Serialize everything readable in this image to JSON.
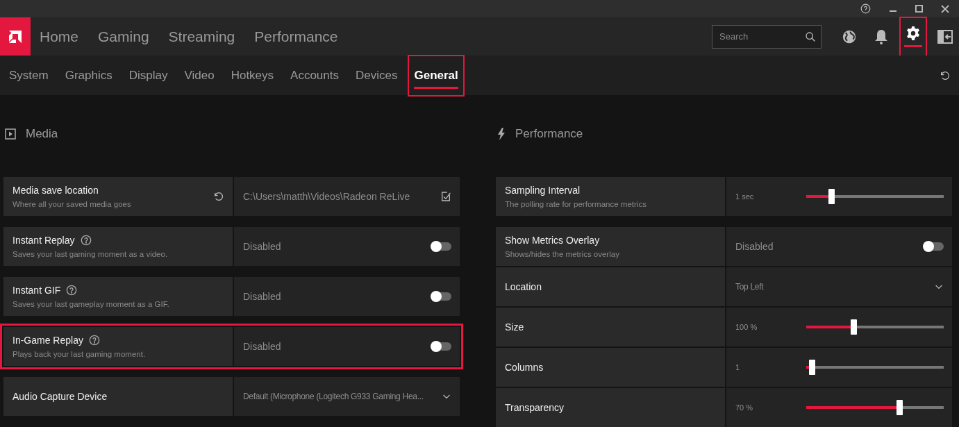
{
  "nav": {
    "tabs": [
      {
        "label": "Home",
        "selected": false
      },
      {
        "label": "Gaming",
        "selected": false
      },
      {
        "label": "Streaming",
        "selected": false
      },
      {
        "label": "Performance",
        "selected": false
      }
    ],
    "search": {
      "placeholder": "Search"
    },
    "settings_highlighted": true
  },
  "subtabs": [
    {
      "label": "System",
      "selected": false,
      "highlighted": false
    },
    {
      "label": "Graphics",
      "selected": false,
      "highlighted": false
    },
    {
      "label": "Display",
      "selected": false,
      "highlighted": false
    },
    {
      "label": "Video",
      "selected": false,
      "highlighted": false
    },
    {
      "label": "Hotkeys",
      "selected": false,
      "highlighted": false
    },
    {
      "label": "Accounts",
      "selected": false,
      "highlighted": false
    },
    {
      "label": "Devices",
      "selected": false,
      "highlighted": false
    },
    {
      "label": "General",
      "selected": true,
      "highlighted": true
    }
  ],
  "media": {
    "title": "Media",
    "groups": [
      [
        {
          "kind": "path",
          "title": "Media save location",
          "subtitle": "Where all your saved media goes",
          "value": "C:\\Users\\matth\\Videos\\Radeon ReLive",
          "help": false,
          "highlighted": false
        }
      ],
      [
        {
          "kind": "toggle",
          "title": "Instant Replay",
          "subtitle": "Saves your last gaming moment as a video.",
          "value": "Disabled",
          "on": false,
          "help": true,
          "highlighted": false
        }
      ],
      [
        {
          "kind": "toggle",
          "title": "Instant GIF",
          "subtitle": "Saves your last gameplay moment as a GIF.",
          "value": "Disabled",
          "on": false,
          "help": true,
          "highlighted": false
        }
      ],
      [
        {
          "kind": "toggle",
          "title": "In-Game Replay",
          "subtitle": "Plays back your last gaming moment.",
          "value": "Disabled",
          "on": false,
          "help": true,
          "highlighted": true
        }
      ],
      [
        {
          "kind": "dropdown",
          "title": "Audio Capture Device",
          "value": "Default (Microphone (Logitech G933 Gaming Hea...",
          "help": false,
          "highlighted": false
        }
      ]
    ]
  },
  "performance": {
    "title": "Performance",
    "groups": [
      [
        {
          "kind": "slider",
          "title": "Sampling Interval",
          "subtitle": "The polling rate for performance metrics",
          "value": "1 sec",
          "level": 0.17
        }
      ],
      [
        {
          "kind": "toggle",
          "title": "Show Metrics Overlay",
          "subtitle": "Shows/hides the metrics overlay",
          "value": "Disabled",
          "on": false
        },
        {
          "kind": "dropdown",
          "title": "Location",
          "value": "Top Left"
        },
        {
          "kind": "slider",
          "title": "Size",
          "value": "100 %",
          "level": 0.34
        },
        {
          "kind": "slider",
          "title": "Columns",
          "value": "1",
          "level": 0.02
        },
        {
          "kind": "slider",
          "title": "Transparency",
          "value": "70 %",
          "level": 0.69
        }
      ]
    ]
  }
}
